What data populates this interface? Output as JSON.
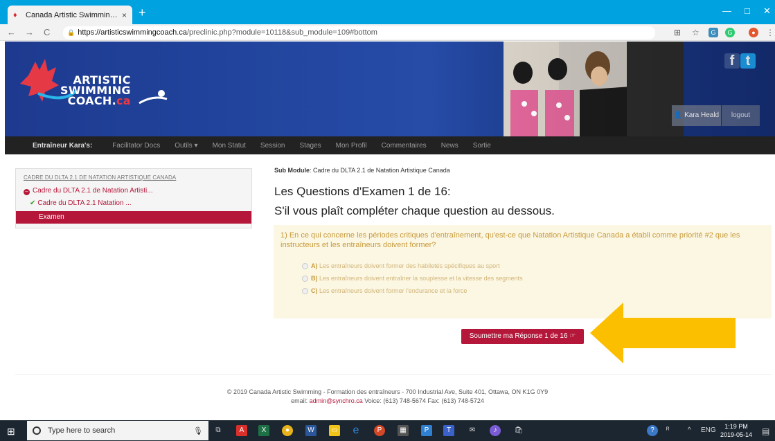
{
  "browser": {
    "tab_title": "Canada Artistic Swimming Entrai",
    "tab_close": "×",
    "new_tab": "+",
    "url_host": "https://artisticswimmingcoach.ca",
    "url_path": "/preclinic.php?module=10118&sub_module=109#bottom",
    "nav_back": "←",
    "nav_forward": "→",
    "nav_reload": "C",
    "win_min": "—",
    "win_max": "□",
    "win_close": "✕"
  },
  "banner": {
    "logo_line1": "ARTISTIC",
    "logo_line2": "SWIMMING",
    "logo_line3a": "COACH.",
    "logo_line3b": "ca",
    "user_name": "Kara Heald",
    "logout": "logout",
    "facebook": "f",
    "twitter": "t"
  },
  "sitenav": {
    "items": [
      "Entraîneur Kara's:",
      "Facilitator Docs",
      "Outils ▾",
      "Mon Statut",
      "Session",
      "Stages",
      "Mon Profil",
      "Commentaires",
      "News",
      "Sortie"
    ]
  },
  "sidebar": {
    "heading": "CADRE DU DLTA 2.1 DE NATATION ARTISTIQUE CANADA",
    "submodule": "Cadre du DLTA 2.1 de Natation Artisti...",
    "done_item": "Cadre du DLTA 2.1 Natation ...",
    "active_item": "Examen"
  },
  "main": {
    "submodule_label": "Sub Module",
    "submodule_value": ": Cadre du DLTA 2.1 de Natation Artistique Canada",
    "title": "Les Questions d'Examen 1 de 16:",
    "subtitle": "S'il vous plaît compléter chaque question au dessous.",
    "question": "1) En ce qui concerne les périodes critiques d'entraînement, qu'est-ce que Natation Artistique Canada a établi comme priorité #2 que les instructeurs et les entraîneurs doivent former?",
    "options": [
      {
        "letter": "A)",
        "text": "Les entraîneurs doivent former des habiletés spécifiques au sport"
      },
      {
        "letter": "B)",
        "text": "Les entraîneurs doivent entraîner la souplesse et la vitesse des segments"
      },
      {
        "letter": "C)",
        "text": "Les entraîneurs doivent former l'endurance et la force"
      }
    ],
    "submit": "Soumettre ma Réponse 1 de 16 ☞"
  },
  "footer": {
    "line1": "© 2019 Canada Artistic Swimming - Formation des entraîneurs - 700 Industrial Ave, Suite 401, Ottawa, ON K1G 0Y9",
    "email_label": "email:",
    "email": "admin@synchro.ca",
    "phones": "Voice: (613) 748-5674 Fax: (613) 748-5724"
  },
  "taskbar": {
    "search_placeholder": "Type here to search",
    "lang": "ENG",
    "time": "1:19 PM",
    "date": "2019-05-14"
  },
  "colors": {
    "accent": "#b5173a",
    "banner_blue": "#264ca8",
    "tab_blue": "#00a3e0",
    "arrow": "#fbbf00"
  }
}
